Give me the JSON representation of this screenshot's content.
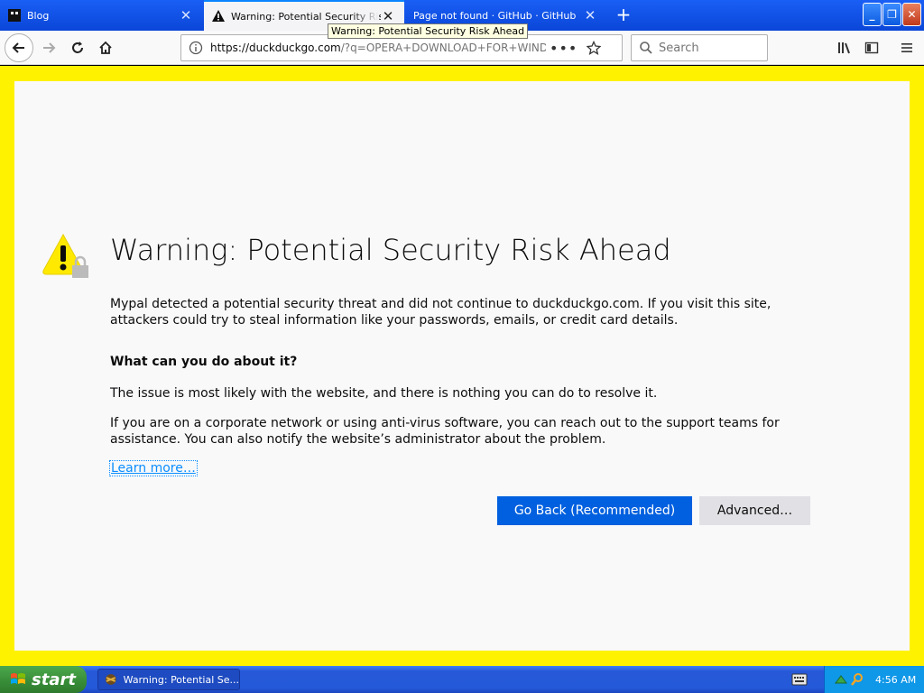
{
  "browser": {
    "tabs": [
      {
        "title": "Blog",
        "icon": "blog-favicon"
      },
      {
        "title": "Warning: Potential Security Risk Ahead",
        "icon": "warning-icon"
      },
      {
        "title": "Page not found · GitHub · GitHub",
        "icon": "none"
      }
    ],
    "tooltip": "Warning: Potential Security Risk Ahead",
    "url": {
      "host": "https://duckduckgo.com",
      "path": "/?q=OPERA+DOWNLOAD+FOR+WINDOWS"
    },
    "search_placeholder": "Search"
  },
  "page": {
    "heading": "Warning: Potential Security Risk Ahead",
    "intro": "Mypal detected a potential security threat and did not continue to duckduckgo.com. If you visit this site, attackers could try to steal information like your passwords, emails, or credit card details.",
    "subheading": "What can you do about it?",
    "para1": "The issue is most likely with the website, and there is nothing you can do to resolve it.",
    "para2": "If you are on a corporate network or using anti-virus software, you can reach out to the support teams for assistance. You can also notify the website’s administrator about the problem.",
    "learn_more": "Learn more…",
    "go_back": "Go Back (Recommended)",
    "advanced": "Advanced…"
  },
  "taskbar": {
    "start": "start",
    "task_title": "Warning: Potential Se...",
    "clock": "4:56 AM"
  },
  "colors": {
    "accent": "#0060df",
    "frame": "#fef200",
    "warning": "#ffe900"
  }
}
